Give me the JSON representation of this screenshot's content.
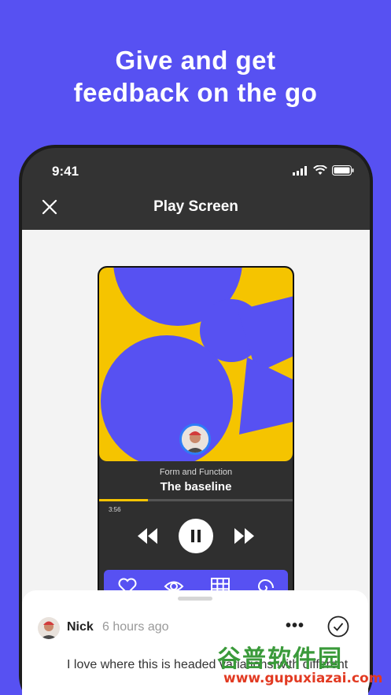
{
  "headline": {
    "line1": "Give and get",
    "line2": "feedback on the go"
  },
  "status_bar": {
    "time": "9:41"
  },
  "nav": {
    "title": "Play Screen"
  },
  "player": {
    "album": "Form and Function",
    "track": "The baseline",
    "elapsed": "3:56",
    "progress": 0.25
  },
  "colors": {
    "brand": "#5751F2",
    "accent": "#F5C400",
    "dark": "#333333"
  },
  "comment": {
    "author": "Nick",
    "time": "6 hours ago",
    "more": "•••",
    "text": "I love where this is headed variations with different"
  },
  "watermark": {
    "cn": "谷普软件园",
    "url": "www.gupuxiazai.com"
  }
}
